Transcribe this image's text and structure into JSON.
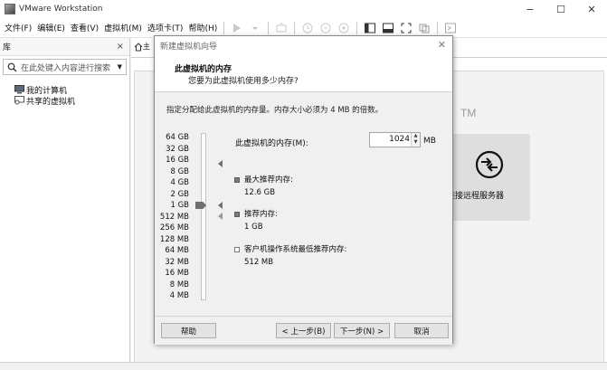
{
  "window": {
    "title": "VMware Workstation",
    "minimize": "−",
    "maximize": "☐",
    "close": "✕"
  },
  "menu": [
    "文件(F)",
    "编辑(E)",
    "查看(V)",
    "虚拟机(M)",
    "选项卡(T)",
    "帮助(H)"
  ],
  "library": {
    "title": "库",
    "close": "×",
    "search_placeholder": "在此处键入内容进行搜索",
    "tree": [
      "我的计算机",
      "共享的虚拟机"
    ]
  },
  "tabs": {
    "home_label": "主"
  },
  "home": {
    "tm": "TM",
    "remote_server_label": "连接远程服务器",
    "bottom_mark": "V"
  },
  "dialog": {
    "title": "新建虚拟机向导",
    "close": "✕",
    "header_title": "此虚拟机的内存",
    "header_subtitle": "您要为此虚拟机使用多少内存?",
    "description": "指定分配给此虚拟机的内存量。内存大小必须为 4 MB 的倍数。",
    "scale_labels": [
      "64 GB",
      "32 GB",
      "16 GB",
      "8 GB",
      "4 GB",
      "2 GB",
      "1 GB",
      "512 MB",
      "256 MB",
      "128 MB",
      "64 MB",
      "32 MB",
      "16 MB",
      "8 MB",
      "4 MB"
    ],
    "memory_label": "此虚拟机的内存(M):",
    "memory_value": "1024",
    "memory_unit": "MB",
    "max_recommended_label": "最大推荐内存:",
    "max_recommended_value": "12.6 GB",
    "recommended_label": "推荐内存:",
    "recommended_value": "1 GB",
    "guest_min_label": "客户机操作系统最低推荐内存:",
    "guest_min_value": "512 MB",
    "buttons": {
      "help": "帮助",
      "back": "< 上一步(B)",
      "next": "下一步(N) >",
      "cancel": "取消"
    }
  }
}
